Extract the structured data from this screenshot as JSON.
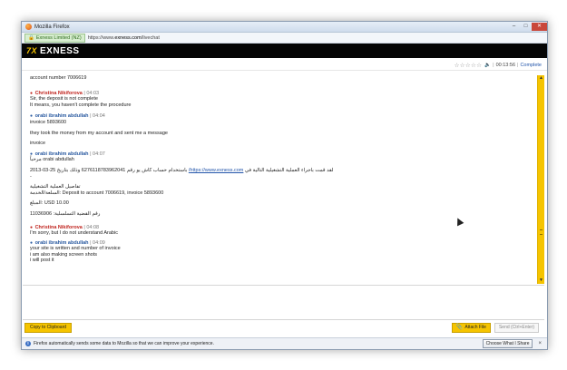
{
  "window": {
    "title": "Mozilla Firefox"
  },
  "urlbar": {
    "identity": "Exness Limited (NZ)",
    "url_prefix": "https://www.",
    "url_host": "exness.com",
    "url_path": "/livechat"
  },
  "brand": {
    "logo_text": "EXNESS",
    "logo_mark": "7X"
  },
  "status": {
    "stars": "☆☆☆☆☆",
    "volume_icon": "speaker-icon",
    "timer": "00:13:56",
    "complete_label": "Complete"
  },
  "chat": {
    "top_line": "account number 7006619",
    "m1": {
      "name": "Christina Nikiforova",
      "time": "04:03",
      "lines": [
        "Sir, the deposit is not complete",
        "It means, you haven't complete the procedure"
      ]
    },
    "m2": {
      "name": "orabi ibrahim abdullah",
      "time": "04:04",
      "l1": "invoice 5893600",
      "l2": "they took the money from my account and sent me a message",
      "l3": "invoice"
    },
    "m3": {
      "name": "orabi ibrahim abdullah",
      "time": "04:07",
      "l1": "مرحباً orabi abdullah",
      "l2_pre": "باستخدام حساب كاش يو رقم 6276118783962041 وذلك بتاريخ 25-03-2013",
      "l2_link": "https://www.exness.com/",
      "l2_post": "لقد قمت باجراء العملية التشغيلية التالية في",
      "l3": "-",
      "l4": "تفاصيل العملية التشغيلية",
      "l5": "السلعة/الخدمة: Deposit to account 7006619, invoice 5893600",
      "l6": "المبلغ: USD 10.00",
      "l7": "رقم القضية التسلسلية: 11036906"
    },
    "m4": {
      "name": "Christina Nikiforova",
      "time": "04:08",
      "l1": "I'm sorry, but I do not understand Arabic"
    },
    "m5": {
      "name": "orabi ibrahim abdullah",
      "time": "04:09",
      "lines": [
        "your site is written and number of invoice",
        "i am also making screen shots",
        "i will post it"
      ]
    }
  },
  "toolbar": {
    "copy_label": "Copy to Clipboard",
    "attach_label": "Attach File",
    "send_label": "Send (Ctrl+Enter)"
  },
  "notification": {
    "text": "Firefox automatically sends some data to Mozilla so that we can improve your experience.",
    "button": "Choose What I Share",
    "close": "×"
  },
  "colors": {
    "accent": "#f5c400",
    "agent_name": "#c0251f",
    "user_name": "#2a5aa0"
  }
}
